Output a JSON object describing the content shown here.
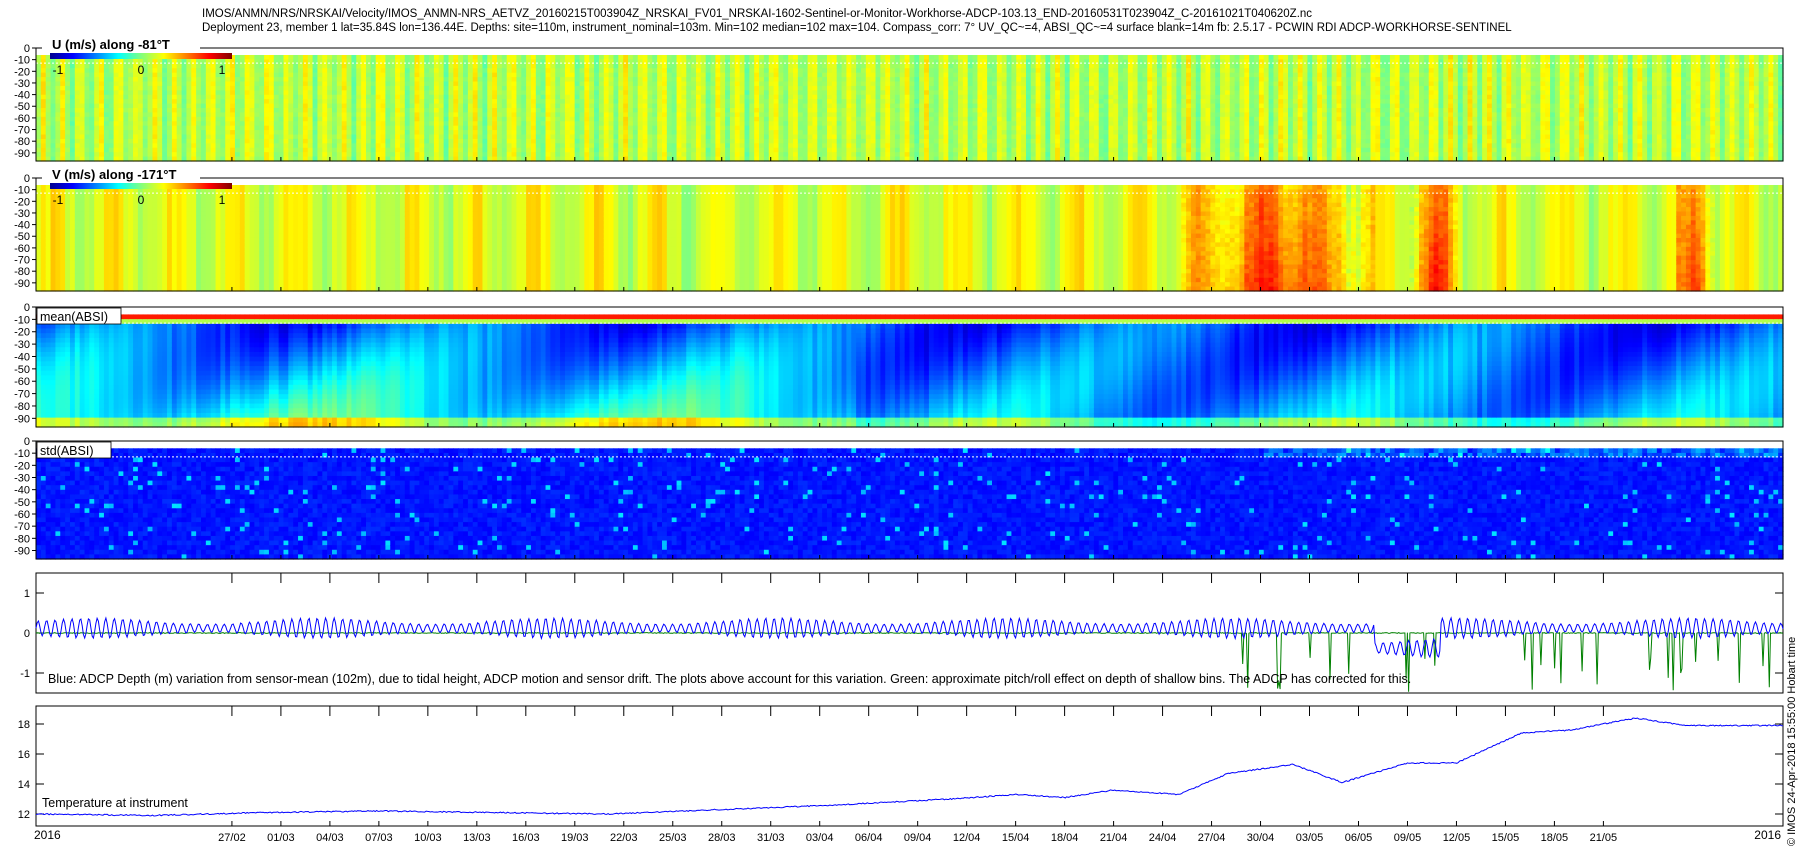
{
  "header": {
    "line1": "IMOS/ANMN/NRS/NRSKAI/Velocity/IMOS_ANMN-NRS_AETVZ_20160215T003904Z_NRSKAI_FV01_NRSKAI-1602-Sentinel-or-Monitor-Workhorse-ADCP-103.13_END-20160531T023904Z_C-20161021T040620Z.nc",
    "line2": "Deployment 23, member 1 lat=35.84S lon=136.44E. Depths: site=110m, instrument_nominal=103m. Min=102 median=102 max=104. Compass_corr: 7° UV_QC~=4, ABSI_QC~=4 surface blank=14m fb: 2.5.17 - PCWIN RDI ADCP-WORKHORSE-SENTINEL"
  },
  "side_stamp": "© IMOS 24-Apr-2018 15:55:00 Hobart time",
  "x_axis": {
    "year_start": "2016",
    "year_end": "2016",
    "ticks": [
      "27/02",
      "01/03",
      "04/03",
      "07/03",
      "10/03",
      "13/03",
      "16/03",
      "19/03",
      "22/03",
      "25/03",
      "28/03",
      "31/03",
      "03/04",
      "06/04",
      "09/04",
      "12/04",
      "15/04",
      "18/04",
      "21/04",
      "24/04",
      "27/04",
      "30/04",
      "03/05",
      "06/05",
      "09/05",
      "12/05",
      "15/05",
      "18/05",
      "21/05"
    ]
  },
  "colors": {
    "blue_line": "#0000ff",
    "green_line": "#008000",
    "temp_line": "#0000ff",
    "blanking_line": "#ffffff"
  },
  "chart_data": [
    {
      "type": "heatmap",
      "id": "u-velocity",
      "title": "U (m/s) along -81°T",
      "colorbar_ticks": [
        "-1",
        "0",
        "1"
      ],
      "y_ticks": [
        "0",
        "-10",
        "-20",
        "-30",
        "-40",
        "-50",
        "-60",
        "-70",
        "-80",
        "-90"
      ],
      "ylim": [
        -97,
        0
      ],
      "clim": [
        -1,
        1
      ],
      "colormap": "jet",
      "description_values": "mostly near 0 to slightly positive (green) with small variations"
    },
    {
      "type": "heatmap",
      "id": "v-velocity",
      "title": "V (m/s) along -171°T",
      "colorbar_ticks": [
        "-1",
        "0",
        "1"
      ],
      "y_ticks": [
        "0",
        "-10",
        "-20",
        "-30",
        "-40",
        "-50",
        "-60",
        "-70",
        "-80",
        "-90"
      ],
      "ylim": [
        -97,
        0
      ],
      "clim": [
        -1,
        1
      ],
      "colormap": "jet",
      "description_values": "near 0 to 0.4 with strong positive events (~0.8) around 28/04-05/05, 09/05 and 22/05"
    },
    {
      "type": "heatmap",
      "id": "mean-absi",
      "title": "mean(ABSI)",
      "y_ticks": [
        "0",
        "-10",
        "-20",
        "-30",
        "-40",
        "-50",
        "-60",
        "-70",
        "-80",
        "-90"
      ],
      "ylim": [
        -97,
        0
      ],
      "colormap": "jet"
    },
    {
      "type": "heatmap",
      "id": "std-absi",
      "title": "std(ABSI)",
      "y_ticks": [
        "0",
        "-10",
        "-20",
        "-30",
        "-40",
        "-50",
        "-60",
        "-70",
        "-80",
        "-90"
      ],
      "ylim": [
        -97,
        0
      ],
      "colormap": "jet"
    },
    {
      "type": "line",
      "id": "depth-variation",
      "annotation": "Blue: ADCP Depth (m) variation from sensor-mean (102m), due to tidal height, ADCP motion and sensor drift. The plots above account for this variation. Green: approximate pitch/roll effect on depth of shallow bins. The ADCP has corrected for this.",
      "y_ticks": [
        "1",
        "0",
        "-1"
      ],
      "ylim": [
        -1.5,
        1.5
      ],
      "series": [
        {
          "color": "blue",
          "mean": 0.1,
          "amplitude": 0.25
        },
        {
          "color": "green",
          "mean": 0.0,
          "amplitude": 0.05
        }
      ]
    },
    {
      "type": "line",
      "id": "temperature",
      "annotation": "Temperature at instrument",
      "y_ticks": [
        "18",
        "16",
        "14",
        "12"
      ],
      "ylim": [
        11.2,
        19.2
      ],
      "x_days": [
        0,
        7,
        14,
        21,
        28,
        35,
        42,
        49,
        56,
        60,
        63,
        66,
        70,
        73,
        77,
        80,
        84,
        87,
        91,
        94,
        98,
        101,
        105
      ],
      "values": [
        12.0,
        11.9,
        12.1,
        12.2,
        12.1,
        12.0,
        12.3,
        12.6,
        13.0,
        13.3,
        13.1,
        13.6,
        13.3,
        14.7,
        15.3,
        14.1,
        15.4,
        15.4,
        17.4,
        17.6,
        18.4,
        17.9,
        17.9
      ]
    }
  ]
}
